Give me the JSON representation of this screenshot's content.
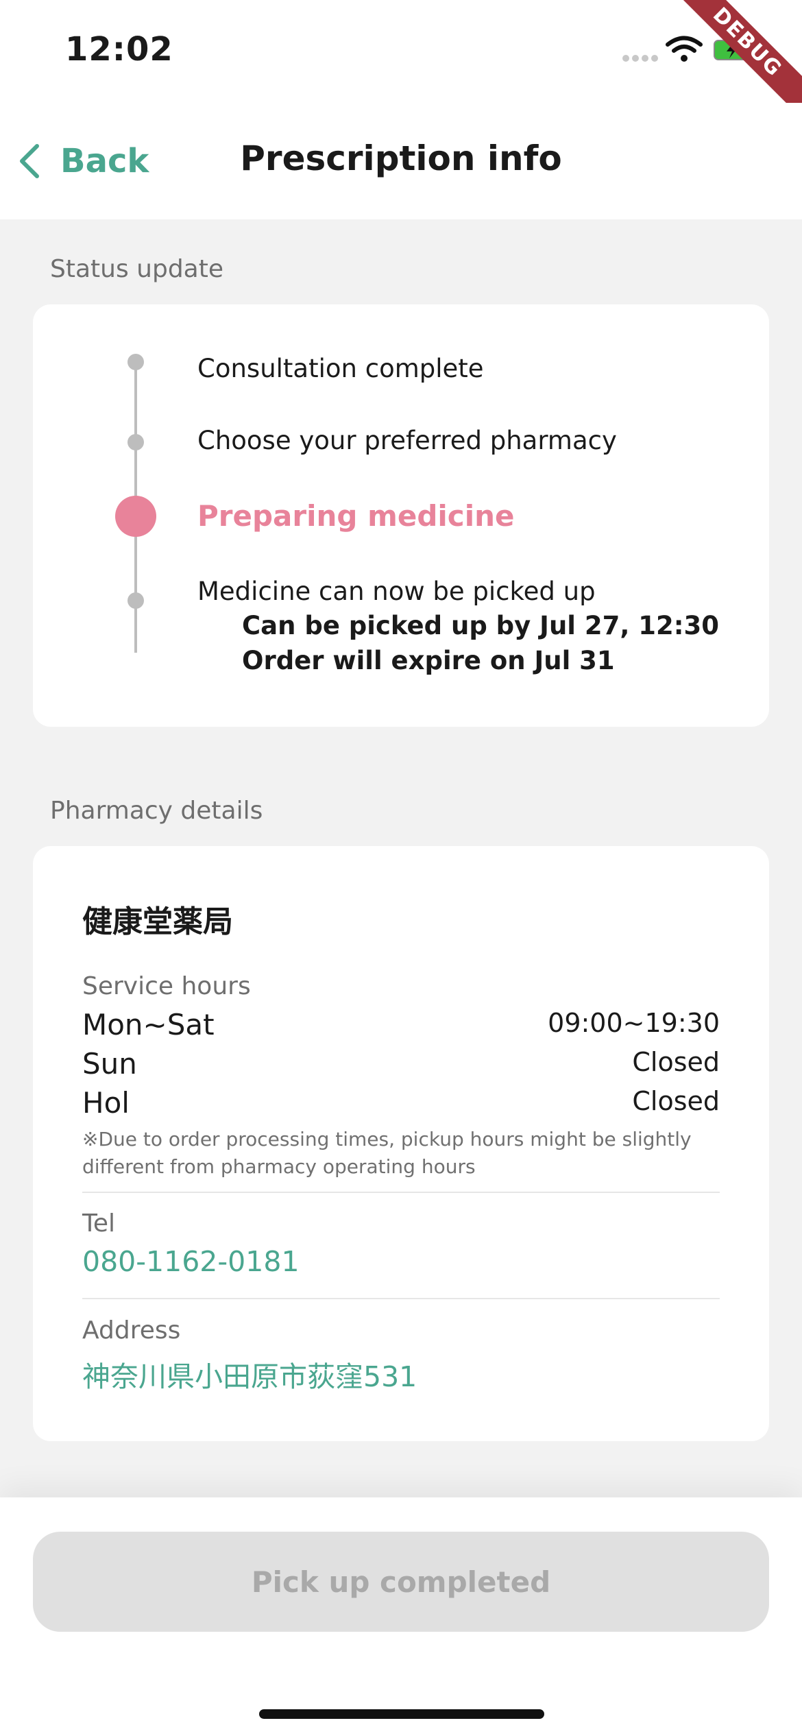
{
  "status_bar": {
    "time": "12:02",
    "debug_label": "DEBUG"
  },
  "nav": {
    "back_label": "Back",
    "title": "Prescription info"
  },
  "status_section": {
    "label": "Status update",
    "steps": [
      {
        "label": "Consultation complete"
      },
      {
        "label": "Choose your preferred pharmacy"
      },
      {
        "label": "Preparing medicine",
        "active": true
      },
      {
        "label": "Medicine can now be picked up"
      }
    ],
    "pickup_by": "Can be picked up by Jul 27, 12:30",
    "expire": "Order will expire on Jul 31"
  },
  "pharmacy_section": {
    "label": "Pharmacy details",
    "name": "健康堂薬局",
    "service_hours_label": "Service hours",
    "hours": [
      {
        "day": "Mon~Sat",
        "time": "09:00~19:30"
      },
      {
        "day": "Sun",
        "time": "Closed"
      },
      {
        "day": "Hol",
        "time": "Closed"
      }
    ],
    "note": "※Due to order processing times, pickup hours might be slightly different from pharmacy operating hours",
    "tel_label": "Tel",
    "tel": "080-1162-0181",
    "address_label": "Address",
    "address": "神奈川県小田原市荻窪531"
  },
  "bottom": {
    "button_label": "Pick up completed"
  },
  "colors": {
    "accent": "#4aa68f",
    "active_step": "#e8839a",
    "inactive": "#bdbdbd"
  }
}
